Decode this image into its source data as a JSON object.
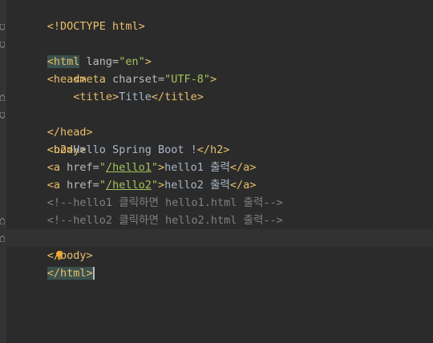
{
  "editor": {
    "lines": {
      "l1": "<!DOCTYPE html>",
      "l2_open": "<html",
      "l2_attr": " lang=",
      "l2_val": "\"en\"",
      "l2_close": ">",
      "l3": "<head>",
      "l4_indent": "    ",
      "l4_open": "<meta",
      "l4_attr": " charset=",
      "l4_val": "\"UTF-8\"",
      "l4_close": ">",
      "l5_indent": "    ",
      "l5_open": "<title>",
      "l5_text": "Title",
      "l5_close": "</title>",
      "l6": "</head>",
      "l7": "<body>",
      "l8_open": "<h2>",
      "l8_text": "Hello Spring Boot !",
      "l8_close": "</h2>",
      "l9_open": "<a",
      "l9_attr": " href=",
      "l9_q1": "\"",
      "l9_link": "/hello1",
      "l9_q2": "\"",
      "l9_gt": ">",
      "l9_text_a": "hello1 ",
      "l9_text_b": "출력",
      "l9_close": "</a>",
      "l10_open": "<a",
      "l10_attr": " href=",
      "l10_q1": "\"",
      "l10_link": "/hello2",
      "l10_q2": "\"",
      "l10_gt": ">",
      "l10_text_a": "hello2 ",
      "l10_text_b": "출력",
      "l10_close": "</a>",
      "l11_a": "<!--hello1 ",
      "l11_b": "클릭하면",
      "l11_c": " hello1.html ",
      "l11_d": "출력",
      "l11_e": "-->",
      "l12_a": "<!--hello2 ",
      "l12_b": "클릭하면",
      "l12_c": " hello2.html ",
      "l12_d": "출력",
      "l12_e": "-->",
      "l13_a": "</",
      "l13_b": "body>",
      "l14": "</html>"
    }
  }
}
